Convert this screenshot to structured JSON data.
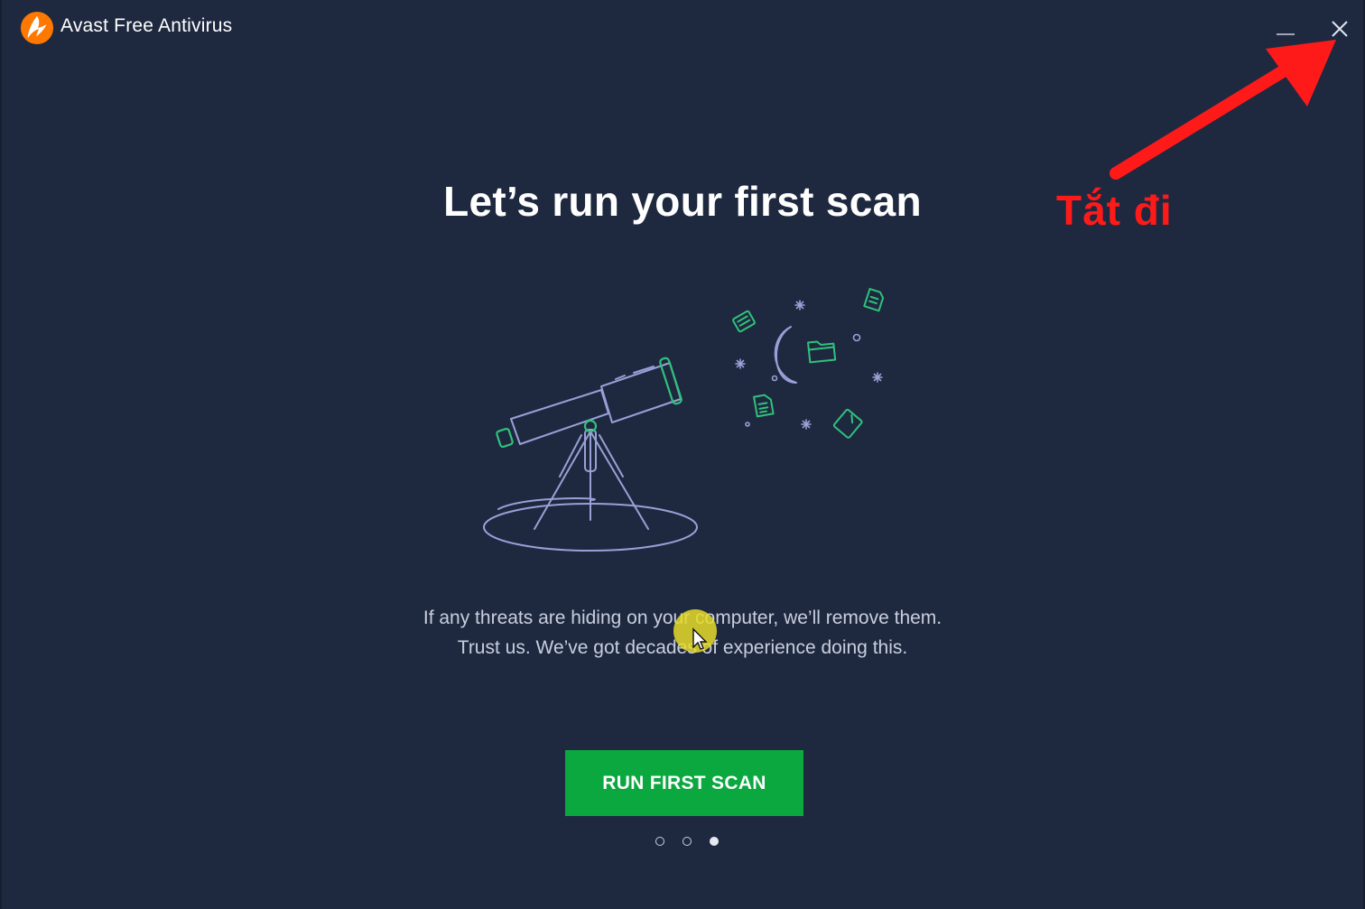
{
  "window": {
    "title": "Avast Free Antivirus",
    "controls": {
      "minimize": "minimize-icon",
      "close": "close-icon"
    }
  },
  "main": {
    "headline": "Let’s run your first scan",
    "description_line1": "If any threats are hiding on your computer, we’ll remove them.",
    "description_line2": "Trust us. We’ve got decades of experience doing this.",
    "cta_label": "RUN FIRST SCAN",
    "pager": {
      "total": 3,
      "active": 3
    }
  },
  "annotation": {
    "text": "Tắt đi",
    "color": "#ff1a1a"
  },
  "colors": {
    "background": "#1e2940",
    "accent": "#0aa83f",
    "brand_orange": "#ff7800",
    "illustration_line": "#9aa0d6",
    "illustration_green": "#2fc27a"
  },
  "icons": [
    "avast-logo-icon",
    "minimize-icon",
    "close-icon",
    "telescope-illustration",
    "moon-icon",
    "star-icon",
    "document-icon",
    "folder-icon",
    "mouse-cursor-icon"
  ]
}
